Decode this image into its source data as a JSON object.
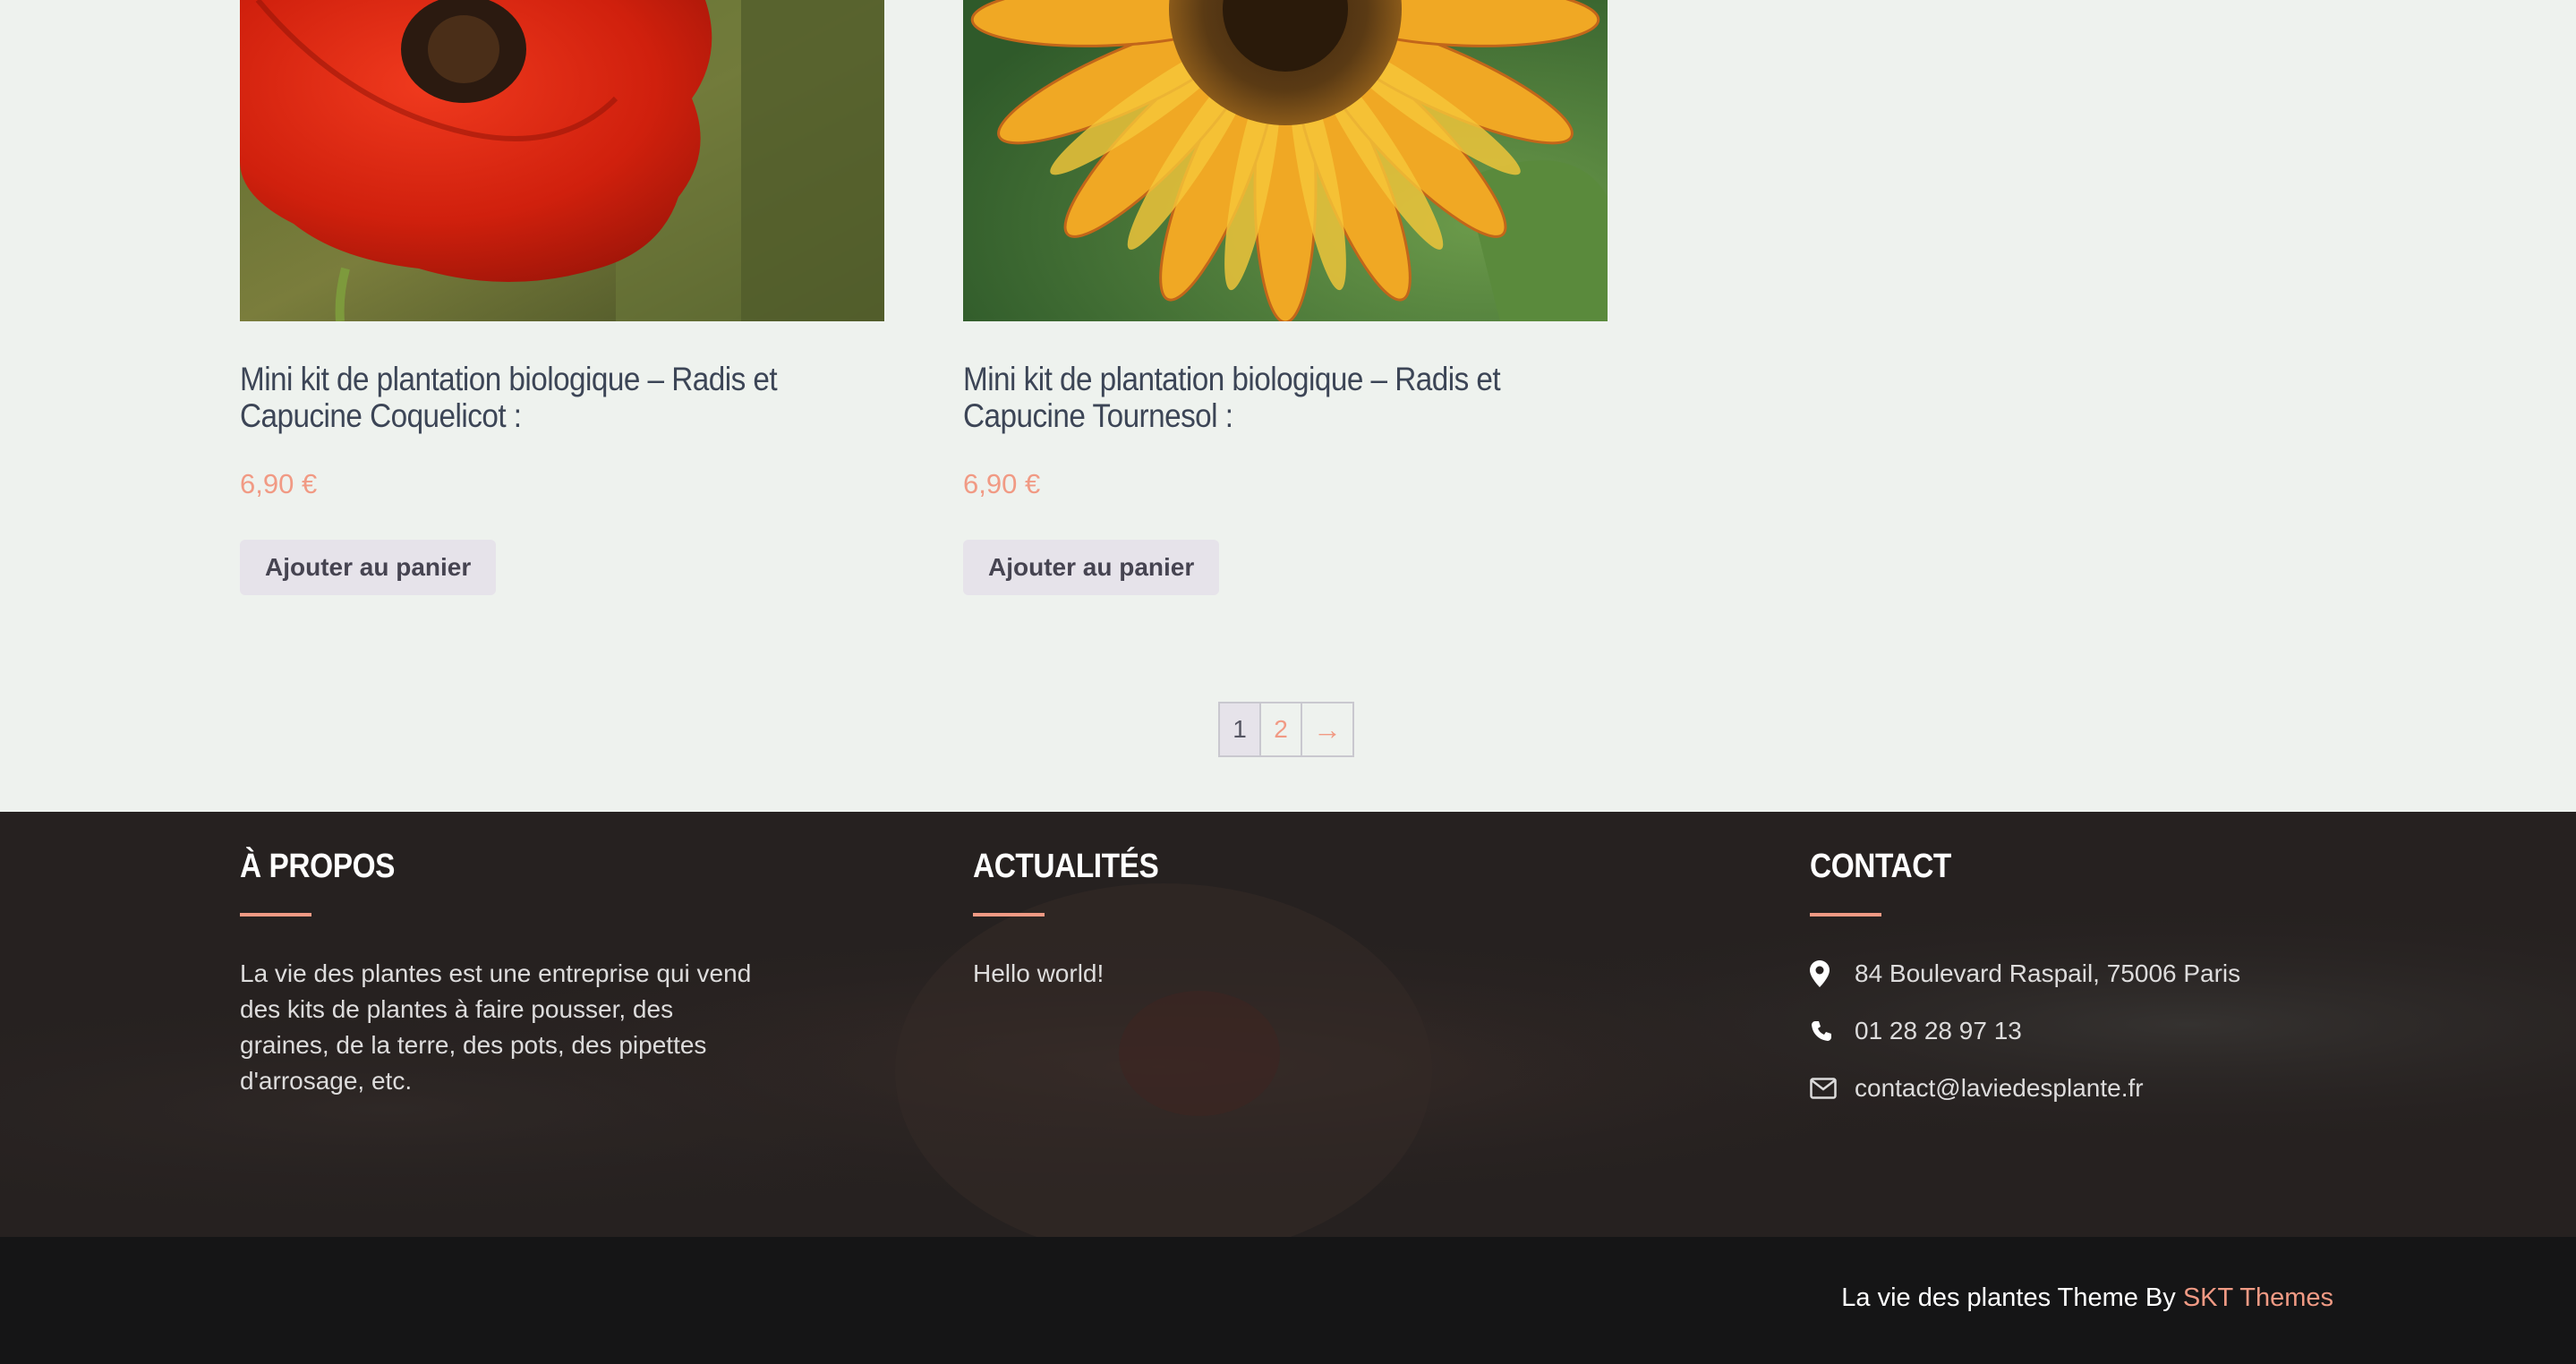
{
  "products": [
    {
      "title": "Mini kit de plantation biologique – Radis et Capucine Coquelicot :",
      "price": "6,90 €",
      "button": "Ajouter au panier",
      "image": "red-poppy-photo"
    },
    {
      "title": "Mini kit de plantation biologique – Radis et Capucine Tournesol :",
      "price": "6,90 €",
      "button": "Ajouter au panier",
      "image": "sunflower-photo"
    }
  ],
  "pagination": {
    "current": "1",
    "page2": "2",
    "next": "→"
  },
  "footer": {
    "about": {
      "title": "À PROPOS",
      "text": "La vie des plantes est une entreprise qui vend des kits de plantes à faire pousser, des graines, de la terre, des pots, des pipettes d'arrosage, etc."
    },
    "news": {
      "title": "ACTUALITÉS",
      "item": "Hello world!"
    },
    "contact": {
      "title": "CONTACT",
      "address": "84 Boulevard Raspail, 75006 Paris",
      "phone": "01 28 28 97 13",
      "email": "contact@laviedesplante.fr"
    }
  },
  "bottom_bar": {
    "credit_prefix": "La vie des plantes Theme By ",
    "credit_link": "SKT Themes"
  },
  "colors": {
    "accent": "#f19a84",
    "footer_bg": "#262120",
    "bottom_bg": "#151516",
    "page_bg": "#eef2ee"
  }
}
